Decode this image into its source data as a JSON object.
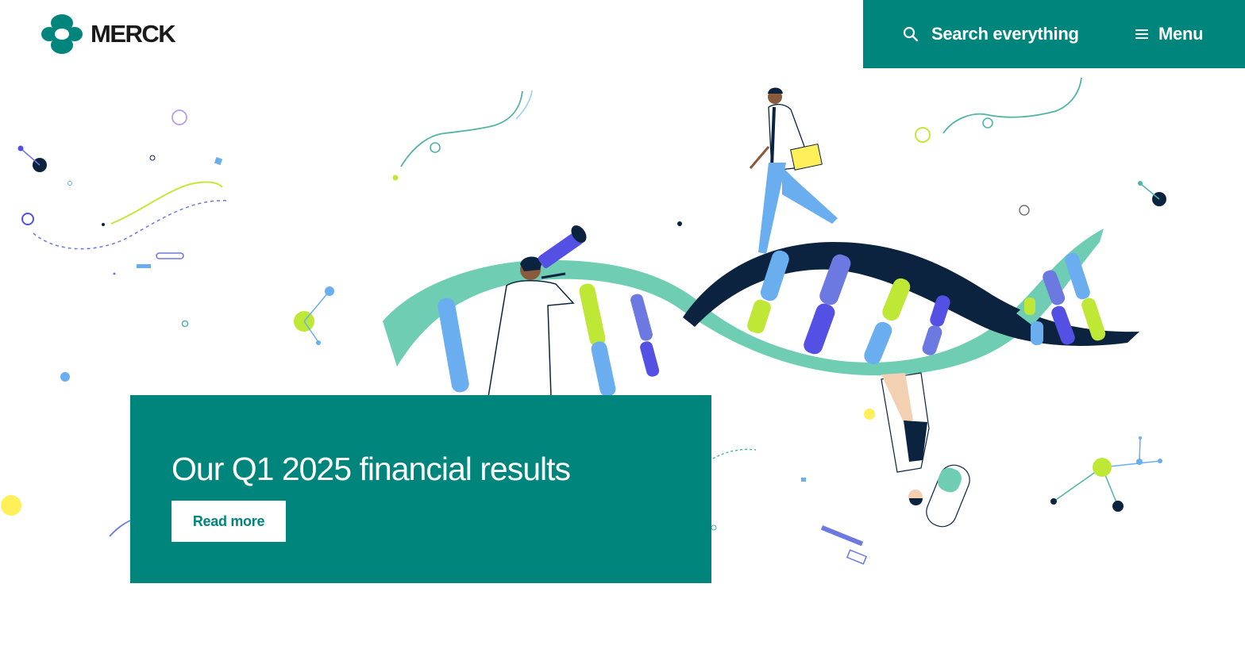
{
  "brand": {
    "name": "MERCK",
    "color": "#00857c"
  },
  "header": {
    "search_label": "Search everything",
    "search_icon": "search-icon",
    "menu_label": "Menu",
    "menu_icon": "hamburger-icon"
  },
  "hero": {
    "title": "Our Q1 2025 financial results",
    "cta_label": "Read more",
    "illustration": "dna-helix-scientists-illustration"
  },
  "colors": {
    "teal": "#00857c",
    "mint": "#6fcdb4",
    "navy": "#0c2340",
    "blue": "#6aaef0",
    "indigo": "#5450e4",
    "lime": "#bfe836",
    "yellow": "#fff05a"
  }
}
